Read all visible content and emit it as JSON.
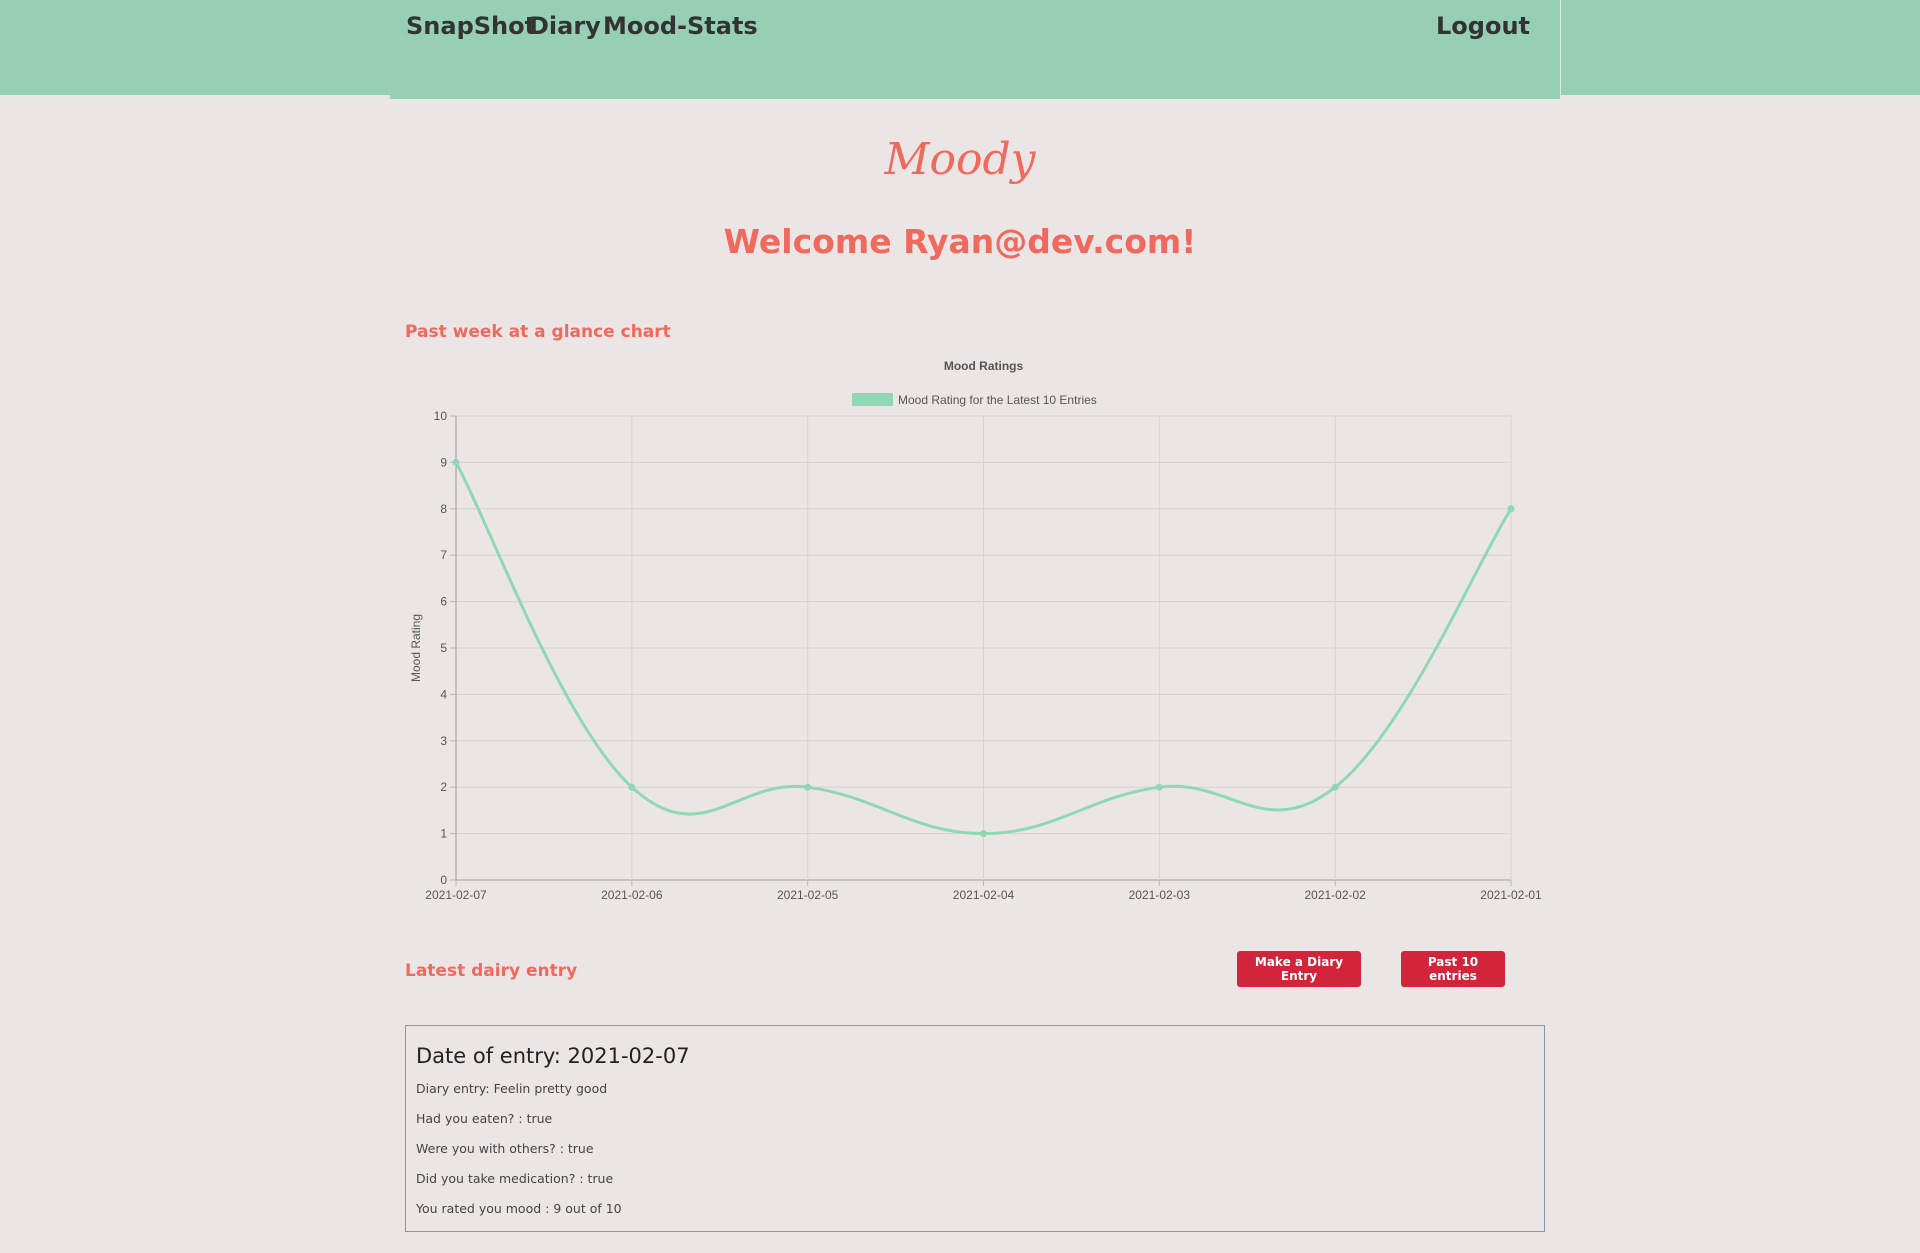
{
  "nav": {
    "links": [
      "SnapShot",
      "Diary",
      "Mood-Stats"
    ],
    "logout": "Logout"
  },
  "brand": "Moody",
  "welcome": "Welcome Ryan@dev.com!",
  "chart_section_title": "Past week at a glance chart",
  "chart_data": {
    "type": "line",
    "title": "Mood Ratings",
    "ylabel": "Mood Rating",
    "xlabel": "",
    "categories": [
      "2021-02-07",
      "2021-02-06",
      "2021-02-05",
      "2021-02-04",
      "2021-02-03",
      "2021-02-02",
      "2021-02-01"
    ],
    "series": [
      {
        "name": "Mood Rating for the Latest 10 Entries",
        "values": [
          9,
          2,
          2,
          1,
          2,
          2,
          8
        ],
        "color": "#8ed9b4"
      }
    ],
    "ylim": [
      0,
      10
    ],
    "yticks": [
      "0",
      "1",
      "2",
      "3",
      "4",
      "5",
      "6",
      "7",
      "8",
      "9",
      "10"
    ],
    "grid": true,
    "legend": "top-center"
  },
  "entry_section_title": "Latest dairy entry",
  "buttons": {
    "make_entry": "Make a Diary Entry",
    "past_entries": "Past 10 entries"
  },
  "entry": {
    "date": "Date of entry: 2021-02-07",
    "lines": [
      "Diary entry: Feelin pretty good",
      "Had you eaten? : true",
      "Were you with others? : true",
      "Did you take medication? : true",
      "You rated you mood : 9 out of 10"
    ]
  },
  "colors": {
    "nav_bg": "#97cfb4",
    "page_bg": "#ebe6e5",
    "accent": "#f0695d",
    "button": "#d2253c",
    "line": "#8ed9b4"
  }
}
